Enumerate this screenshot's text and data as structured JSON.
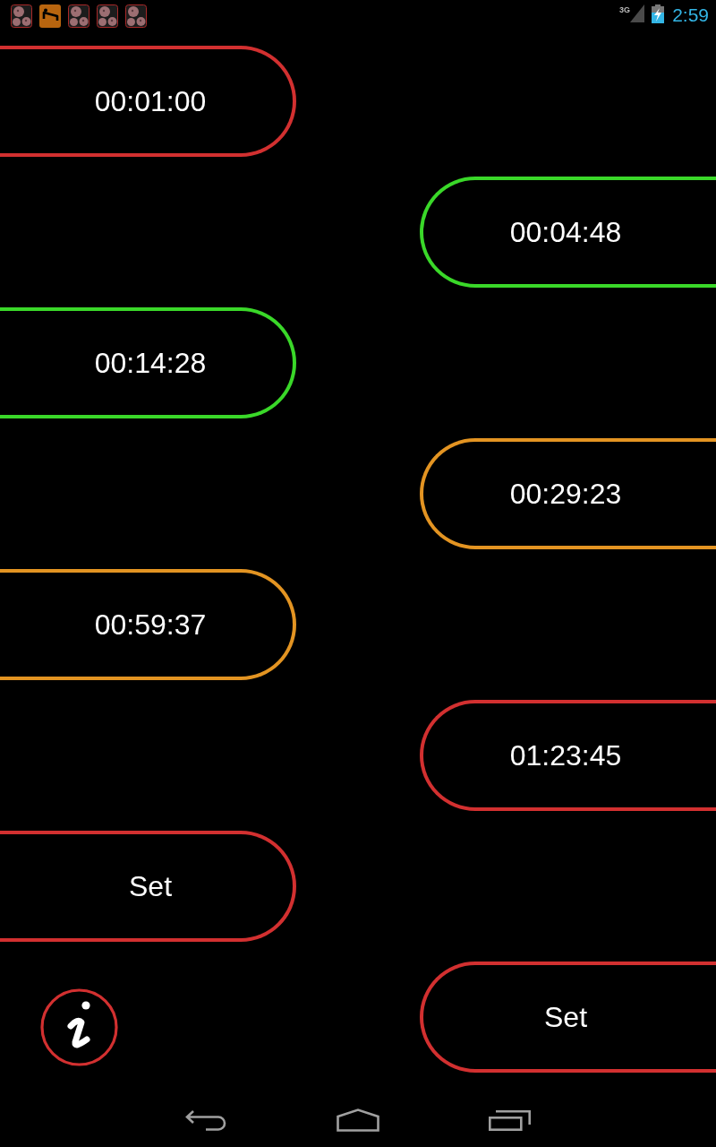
{
  "status_bar": {
    "network_type": "3G",
    "time": "2:59"
  },
  "timers": [
    {
      "label": "00:01:00",
      "color": "#d23030"
    },
    {
      "label": "00:04:48",
      "color": "#3ad829"
    },
    {
      "label": "00:14:28",
      "color": "#3ad829"
    },
    {
      "label": "00:29:23",
      "color": "#e39422"
    },
    {
      "label": "00:59:37",
      "color": "#e39422"
    },
    {
      "label": "01:23:45",
      "color": "#d23030"
    },
    {
      "label": "Set",
      "color": "#d23030"
    },
    {
      "label": "Set",
      "color": "#d23030"
    }
  ]
}
